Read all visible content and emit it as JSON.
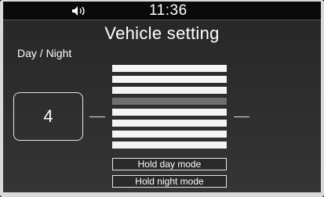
{
  "status_bar": {
    "volume_icon": "speaker-icon",
    "time": "11:36"
  },
  "title": "Vehicle setting",
  "section_label": "Day / Night",
  "brightness": {
    "value": "4",
    "level": 4,
    "min": 1,
    "max": 8
  },
  "buttons": {
    "hold_day": "Hold day mode",
    "hold_night": "Hold night mode"
  },
  "colors": {
    "segment_filled": "#f4f4f4",
    "segment_active": "#6f6f6f",
    "background": "#2c2c2c"
  }
}
